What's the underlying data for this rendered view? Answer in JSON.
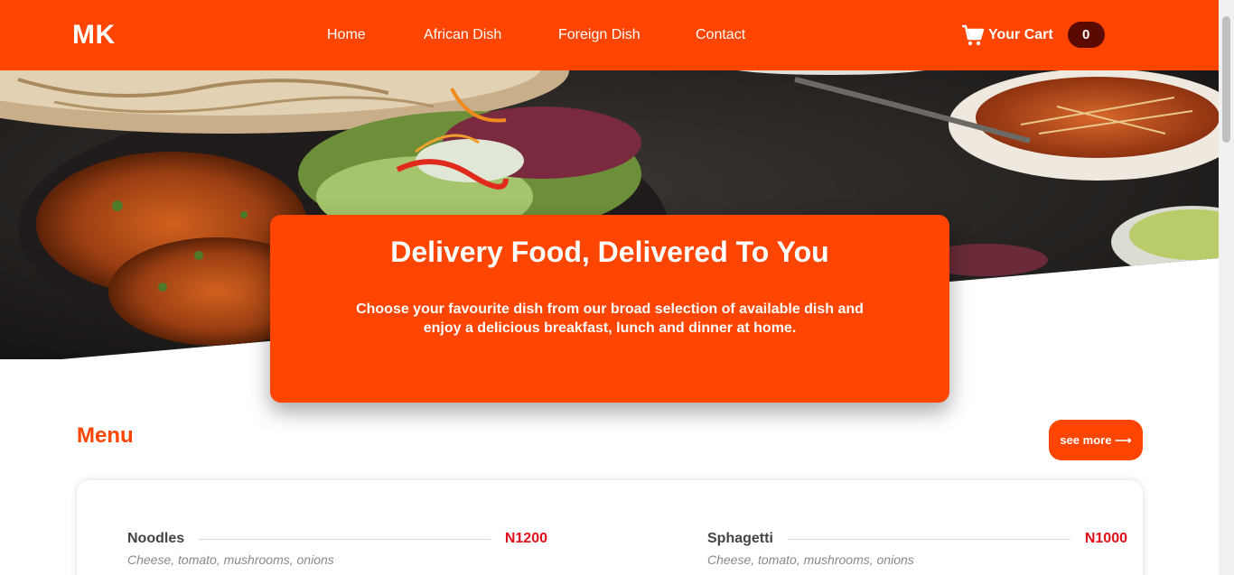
{
  "header": {
    "logo": "MK",
    "nav": [
      "Home",
      "African Dish",
      "Foreign Dish",
      "Contact"
    ],
    "cart_label": "Your Cart",
    "cart_count": "0"
  },
  "hero": {
    "title": "Delivery Food, Delivered To You",
    "subtitle": "Choose your favourite dish from our broad selection of available dish and enjoy a delicious breakfast, lunch and dinner at home."
  },
  "menu": {
    "title": "Menu",
    "see_more": "see more ⟶",
    "items": [
      {
        "name": "Noodles",
        "price": "N1200",
        "desc": "Cheese, tomato, mushrooms, onions"
      },
      {
        "name": "Sphagetti",
        "price": "N1000",
        "desc": "Cheese, tomato, mushrooms, onions"
      }
    ]
  },
  "colors": {
    "accent": "#ff4500",
    "cart_badge": "#5a0a00",
    "price": "#e0101a"
  },
  "icons": {
    "cart": "shopping-cart-icon"
  }
}
